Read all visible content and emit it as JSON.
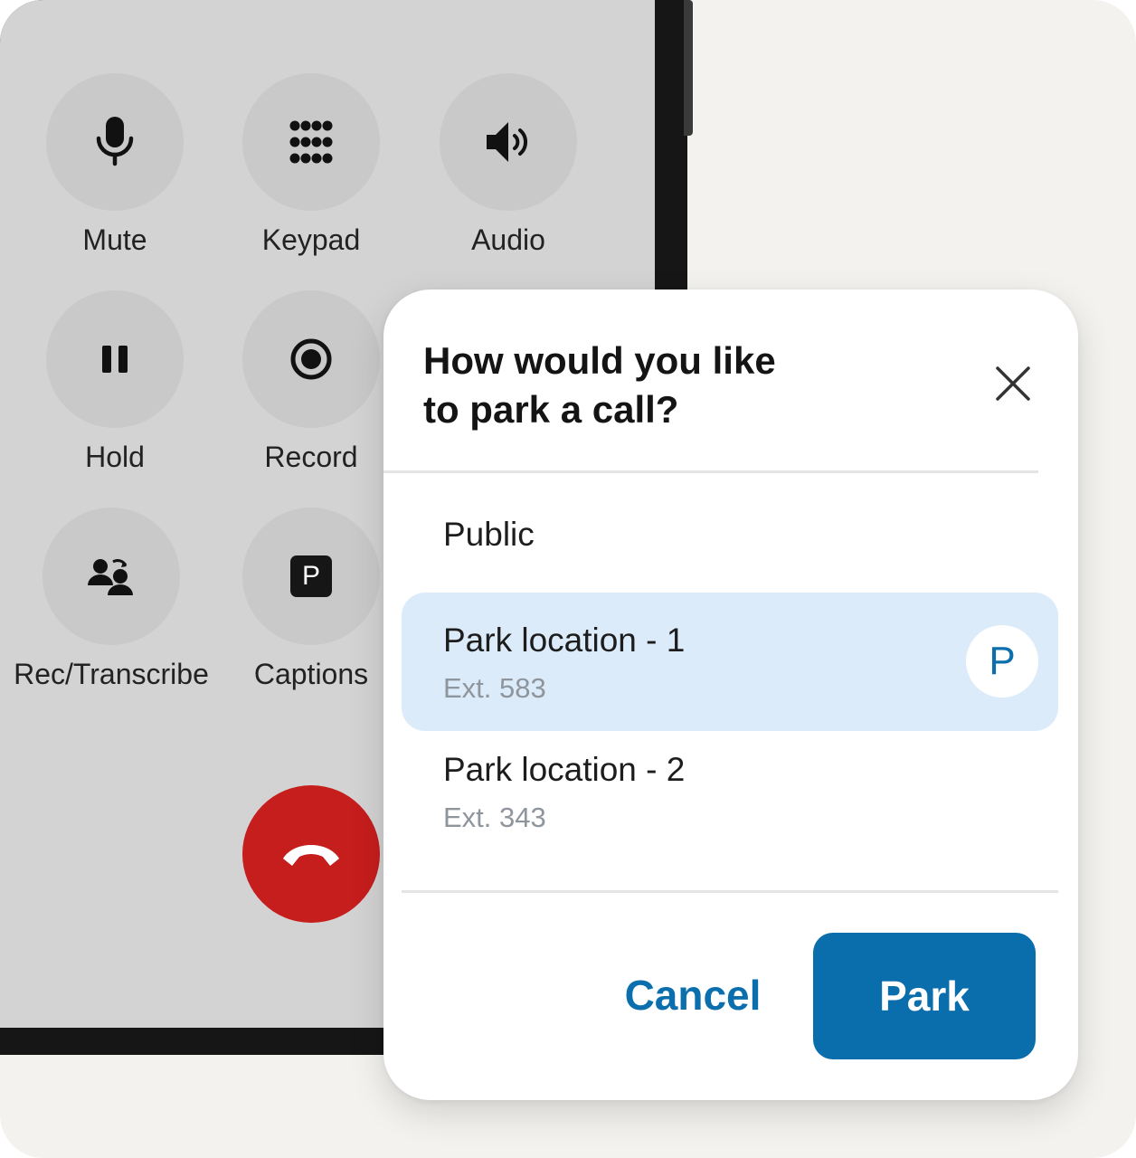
{
  "call_controls": [
    {
      "id": "mute",
      "label": "Mute",
      "icon": "microphone-icon"
    },
    {
      "id": "keypad",
      "label": "Keypad",
      "icon": "keypad-grid-icon"
    },
    {
      "id": "audio",
      "label": "Audio",
      "icon": "speaker-icon"
    },
    {
      "id": "hold",
      "label": "Hold",
      "icon": "pause-icon"
    },
    {
      "id": "record",
      "label": "Record",
      "icon": "record-icon"
    },
    {
      "id": "rec-transcribe",
      "label": "Rec/Transcribe",
      "icon": "users-transcribe-icon"
    },
    {
      "id": "captions",
      "label": "Captions",
      "icon": "park-p-icon",
      "icon_text": "P"
    }
  ],
  "hangup": {
    "icon": "hang-up-phone-icon",
    "color": "#c61d1d"
  },
  "dialog": {
    "title_line1": "How would you like",
    "title_line2": "to park a call?",
    "close_icon": "close-x-icon",
    "options": [
      {
        "label": "Public",
        "sub": "",
        "selected": false
      },
      {
        "label": "Park location - 1",
        "sub": "Ext. 583",
        "selected": true,
        "badge": "P"
      },
      {
        "label": "Park location - 2",
        "sub": "Ext. 343",
        "selected": false
      }
    ],
    "cancel_label": "Cancel",
    "park_label": "Park"
  },
  "colors": {
    "accent": "#0a6ead",
    "selected_bg": "#dbebf9",
    "phone_screen": "#d3d3d3",
    "control_circle": "#c9c9c9"
  }
}
